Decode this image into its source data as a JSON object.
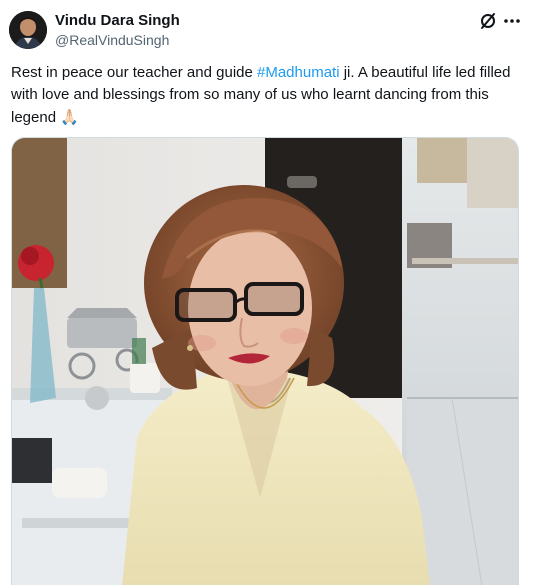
{
  "tweet": {
    "author_name": "Vindu Dara Singh",
    "author_handle": "@RealVinduSingh",
    "text_before": "Rest in peace our teacher and guide ",
    "hashtag": "#Madhumati",
    "text_after": " ji. A beautiful life led filled with love and blessings from so many of us who learnt dancing from this legend ",
    "emoji": "🙏🏻",
    "icons": [
      "grok-icon",
      "more-icon"
    ],
    "media": {
      "type": "photo",
      "description": "photo"
    }
  },
  "colors": {
    "text": "#0f1419",
    "secondary": "#536471",
    "link": "#1d9bf0",
    "border": "#cfd9de"
  }
}
